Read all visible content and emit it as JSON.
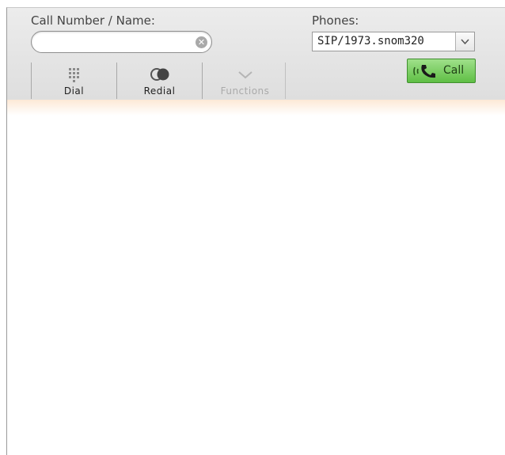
{
  "labels": {
    "call_number": "Call Number / Name:",
    "phones": "Phones:"
  },
  "search": {
    "value": "",
    "placeholder": ""
  },
  "phones_select": {
    "selected": "SIP/1973.snom320"
  },
  "buttons": {
    "call": "Call",
    "dial": "Dial",
    "redial": "Redial",
    "functions": "Functions"
  },
  "icons": {
    "clear": "clear-circle-x-icon",
    "dropdown": "chevron-down-icon",
    "call": "phone-handset-icon",
    "dial": "keypad-icon",
    "redial": "redial-circles-icon",
    "functions": "chevron-down-icon"
  },
  "colors": {
    "call_button_top": "#9fe08a",
    "call_button_bottom": "#5fbf45",
    "toolbar": "#e4e4e4",
    "glow": "#fde9d6"
  }
}
